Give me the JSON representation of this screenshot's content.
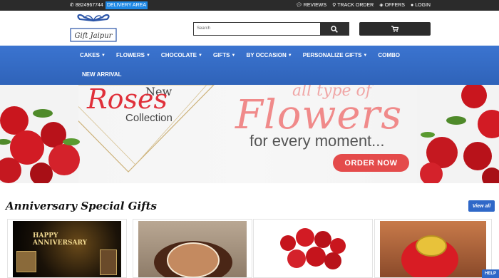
{
  "topbar": {
    "phone": "8824967744",
    "delivery": "DELIVERY AREA",
    "links": [
      {
        "label": "REVIEWS",
        "icon": "comment-icon"
      },
      {
        "label": "TRACK ORDER",
        "icon": "map-pin-icon"
      },
      {
        "label": "OFFERS",
        "icon": "tag-icon"
      },
      {
        "label": "LOGIN",
        "icon": "user-icon"
      }
    ]
  },
  "header": {
    "logo_text": "Gift Jaipur",
    "search_placeholder": "Search"
  },
  "nav": {
    "items": [
      {
        "label": "CAKES"
      },
      {
        "label": "FLOWERS"
      },
      {
        "label": "CHOCOLATE"
      },
      {
        "label": "GIFTS"
      },
      {
        "label": "BY OCCASION"
      },
      {
        "label": "PERSONALIZE GIFTS"
      },
      {
        "label": "COMBO"
      }
    ],
    "second_row": "NEW ARRIVAL"
  },
  "banner": {
    "new": "New",
    "roses": "Roses",
    "collection": "Collection",
    "all_type": "all type of",
    "flowers": "Flowers",
    "every_moment": "for every moment...",
    "order_now": "ORDER NOW"
  },
  "section": {
    "title": "Anniversary Special Gifts",
    "view_all": "View all",
    "card1_text": "HAPPY ANNIVERSARY"
  },
  "help": "HELP",
  "colors": {
    "nav_blue": "#3b74d0",
    "accent_red": "#e44b4b",
    "topbar": "#2b2b2b",
    "highlight": "#1e88e5"
  }
}
